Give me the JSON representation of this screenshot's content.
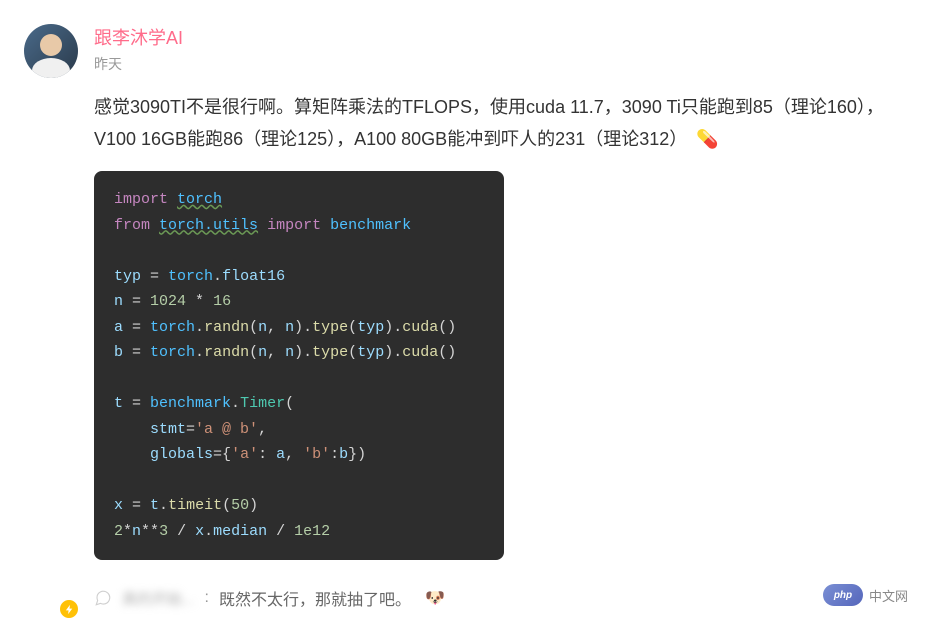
{
  "author": "跟李沐学AI",
  "timestamp": "昨天",
  "post_text": "感觉3090TI不是很行啊。算矩阵乘法的TFLOPS，使用cuda 11.7，3090 Ti只能跑到85（理论160），V100 16GB能跑86（理论125），A100 80GB能冲到吓人的231（理论312）",
  "pill_emoji": "💊",
  "code": {
    "lines": [
      {
        "type": "code",
        "parts": [
          {
            "c": "kw",
            "t": "import"
          },
          {
            "c": "op",
            "t": " "
          },
          {
            "c": "mod-underline",
            "t": "torch"
          }
        ]
      },
      {
        "type": "code",
        "parts": [
          {
            "c": "kw",
            "t": "from"
          },
          {
            "c": "op",
            "t": " "
          },
          {
            "c": "mod-underline",
            "t": "torch.utils"
          },
          {
            "c": "op",
            "t": " "
          },
          {
            "c": "kw",
            "t": "import"
          },
          {
            "c": "op",
            "t": " "
          },
          {
            "c": "mod",
            "t": "benchmark"
          }
        ]
      },
      {
        "type": "blank"
      },
      {
        "type": "code",
        "parts": [
          {
            "c": "var",
            "t": "typ"
          },
          {
            "c": "op",
            "t": " = "
          },
          {
            "c": "mod",
            "t": "torch"
          },
          {
            "c": "punc",
            "t": "."
          },
          {
            "c": "var",
            "t": "float16"
          }
        ]
      },
      {
        "type": "code",
        "parts": [
          {
            "c": "var",
            "t": "n"
          },
          {
            "c": "op",
            "t": " = "
          },
          {
            "c": "num",
            "t": "1024"
          },
          {
            "c": "op",
            "t": " * "
          },
          {
            "c": "num",
            "t": "16"
          }
        ]
      },
      {
        "type": "code",
        "parts": [
          {
            "c": "var",
            "t": "a"
          },
          {
            "c": "op",
            "t": " = "
          },
          {
            "c": "mod",
            "t": "torch"
          },
          {
            "c": "punc",
            "t": "."
          },
          {
            "c": "fn",
            "t": "randn"
          },
          {
            "c": "punc",
            "t": "("
          },
          {
            "c": "var",
            "t": "n"
          },
          {
            "c": "punc",
            "t": ", "
          },
          {
            "c": "var",
            "t": "n"
          },
          {
            "c": "punc",
            "t": ")."
          },
          {
            "c": "fn",
            "t": "type"
          },
          {
            "c": "punc",
            "t": "("
          },
          {
            "c": "var",
            "t": "typ"
          },
          {
            "c": "punc",
            "t": ")."
          },
          {
            "c": "fn",
            "t": "cuda"
          },
          {
            "c": "punc",
            "t": "()"
          }
        ]
      },
      {
        "type": "code",
        "parts": [
          {
            "c": "var",
            "t": "b"
          },
          {
            "c": "op",
            "t": " = "
          },
          {
            "c": "mod",
            "t": "torch"
          },
          {
            "c": "punc",
            "t": "."
          },
          {
            "c": "fn",
            "t": "randn"
          },
          {
            "c": "punc",
            "t": "("
          },
          {
            "c": "var",
            "t": "n"
          },
          {
            "c": "punc",
            "t": ", "
          },
          {
            "c": "var",
            "t": "n"
          },
          {
            "c": "punc",
            "t": ")."
          },
          {
            "c": "fn",
            "t": "type"
          },
          {
            "c": "punc",
            "t": "("
          },
          {
            "c": "var",
            "t": "typ"
          },
          {
            "c": "punc",
            "t": ")."
          },
          {
            "c": "fn",
            "t": "cuda"
          },
          {
            "c": "punc",
            "t": "()"
          }
        ]
      },
      {
        "type": "blank"
      },
      {
        "type": "code",
        "parts": [
          {
            "c": "var",
            "t": "t"
          },
          {
            "c": "op",
            "t": " = "
          },
          {
            "c": "mod",
            "t": "benchmark"
          },
          {
            "c": "punc",
            "t": "."
          },
          {
            "c": "cls",
            "t": "Timer"
          },
          {
            "c": "punc",
            "t": "("
          }
        ]
      },
      {
        "type": "code",
        "parts": [
          {
            "c": "op",
            "t": "    "
          },
          {
            "c": "var",
            "t": "stmt"
          },
          {
            "c": "op",
            "t": "="
          },
          {
            "c": "str",
            "t": "'a @ b'"
          },
          {
            "c": "punc",
            "t": ","
          }
        ]
      },
      {
        "type": "code",
        "parts": [
          {
            "c": "op",
            "t": "    "
          },
          {
            "c": "var",
            "t": "globals"
          },
          {
            "c": "op",
            "t": "="
          },
          {
            "c": "punc",
            "t": "{"
          },
          {
            "c": "str",
            "t": "'a'"
          },
          {
            "c": "punc",
            "t": ": "
          },
          {
            "c": "var",
            "t": "a"
          },
          {
            "c": "punc",
            "t": ", "
          },
          {
            "c": "str",
            "t": "'b'"
          },
          {
            "c": "punc",
            "t": ":"
          },
          {
            "c": "var",
            "t": "b"
          },
          {
            "c": "punc",
            "t": "})"
          }
        ]
      },
      {
        "type": "blank"
      },
      {
        "type": "code",
        "parts": [
          {
            "c": "var",
            "t": "x"
          },
          {
            "c": "op",
            "t": " = "
          },
          {
            "c": "var",
            "t": "t"
          },
          {
            "c": "punc",
            "t": "."
          },
          {
            "c": "fn",
            "t": "timeit"
          },
          {
            "c": "punc",
            "t": "("
          },
          {
            "c": "num",
            "t": "50"
          },
          {
            "c": "punc",
            "t": ")"
          }
        ]
      },
      {
        "type": "code",
        "parts": [
          {
            "c": "num",
            "t": "2"
          },
          {
            "c": "op",
            "t": "*"
          },
          {
            "c": "var",
            "t": "n"
          },
          {
            "c": "op",
            "t": "**"
          },
          {
            "c": "num",
            "t": "3"
          },
          {
            "c": "op",
            "t": " / "
          },
          {
            "c": "var",
            "t": "x"
          },
          {
            "c": "punc",
            "t": "."
          },
          {
            "c": "var",
            "t": "median"
          },
          {
            "c": "op",
            "t": " / "
          },
          {
            "c": "num",
            "t": "1e12"
          }
        ]
      }
    ]
  },
  "comment": {
    "commenter_blurred": "真的开始...",
    "text": "既然不太行，那就抽了吧。",
    "emoji": "🐶"
  },
  "watermark": {
    "logo": "php",
    "text": "中文网"
  }
}
